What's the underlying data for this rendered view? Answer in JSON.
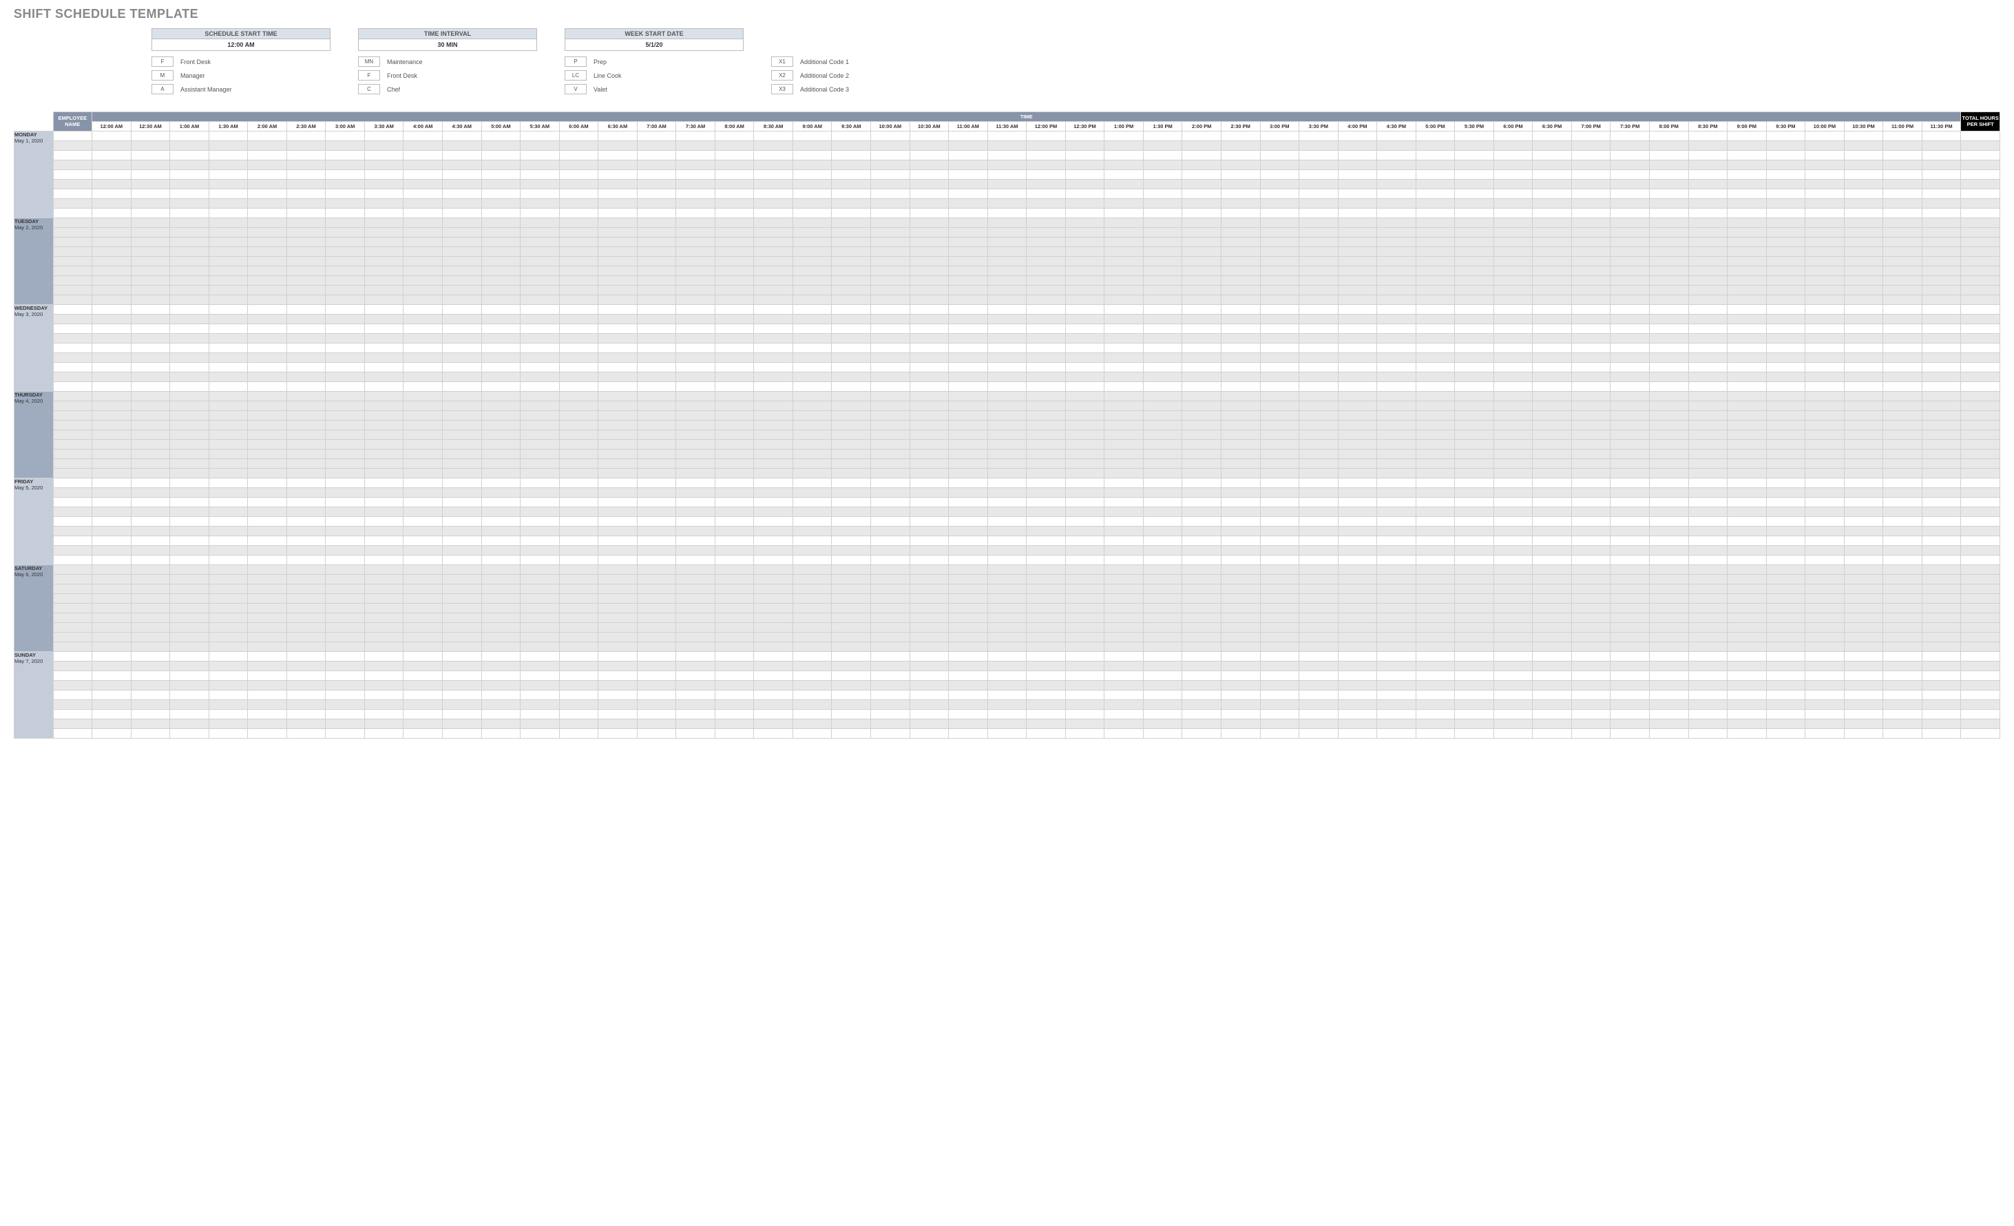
{
  "title": "SHIFT SCHEDULE TEMPLATE",
  "config": {
    "start_time": {
      "label": "SCHEDULE START TIME",
      "value": "12:00 AM"
    },
    "interval": {
      "label": "TIME INTERVAL",
      "value": "30 MIN"
    },
    "week_start": {
      "label": "WEEK START DATE",
      "value": "5/1/20"
    }
  },
  "legend_cols": [
    [
      {
        "code": "F",
        "text": "Front Desk"
      },
      {
        "code": "M",
        "text": "Manager"
      },
      {
        "code": "A",
        "text": "Assistant Manager"
      }
    ],
    [
      {
        "code": "MN",
        "text": "Maintenance"
      },
      {
        "code": "F",
        "text": "Front Desk"
      },
      {
        "code": "C",
        "text": "Chef"
      }
    ],
    [
      {
        "code": "P",
        "text": "Prep"
      },
      {
        "code": "LC",
        "text": "Line Cook"
      },
      {
        "code": "V",
        "text": "Valet"
      }
    ],
    [
      {
        "code": "X1",
        "text": "Additional Code 1"
      },
      {
        "code": "X2",
        "text": "Additional Code 2"
      },
      {
        "code": "X3",
        "text": "Additional Code 3"
      }
    ]
  ],
  "headers": {
    "employee": "EMPLOYEE NAME",
    "time": "TIME",
    "total": "TOTAL HOURS PER SHIFT"
  },
  "time_slots": [
    "12:00 AM",
    "12:30 AM",
    "1:00 AM",
    "1:30 AM",
    "2:00 AM",
    "2:30 AM",
    "3:00 AM",
    "3:30 AM",
    "4:00 AM",
    "4:30 AM",
    "5:00 AM",
    "5:30 AM",
    "6:00 AM",
    "6:30 AM",
    "7:00 AM",
    "7:30 AM",
    "8:00 AM",
    "8:30 AM",
    "9:00 AM",
    "9:30 AM",
    "10:00 AM",
    "10:30 AM",
    "11:00 AM",
    "11:30 AM",
    "12:00 PM",
    "12:30 PM",
    "1:00 PM",
    "1:30 PM",
    "2:00 PM",
    "2:30 PM",
    "3:00 PM",
    "3:30 PM",
    "4:00 PM",
    "4:30 PM",
    "5:00 PM",
    "5:30 PM",
    "6:00 PM",
    "6:30 PM",
    "7:00 PM",
    "7:30 PM",
    "8:00 PM",
    "8:30 PM",
    "9:00 PM",
    "9:30 PM",
    "10:00 PM",
    "10:30 PM",
    "11:00 PM",
    "11:30 PM"
  ],
  "days": [
    {
      "name": "MONDAY",
      "date": "May 1, 2020",
      "alt": false
    },
    {
      "name": "TUESDAY",
      "date": "May 2, 2020",
      "alt": true
    },
    {
      "name": "WEDNESDAY",
      "date": "May 3, 2020",
      "alt": false
    },
    {
      "name": "THURSDAY",
      "date": "May 4, 2020",
      "alt": true
    },
    {
      "name": "FRIDAY",
      "date": "May 5, 2020",
      "alt": false
    },
    {
      "name": "SATURDAY",
      "date": "May 6, 2020",
      "alt": true
    },
    {
      "name": "SUNDAY",
      "date": "May 7, 2020",
      "alt": false
    }
  ],
  "rows_per_day": 9
}
